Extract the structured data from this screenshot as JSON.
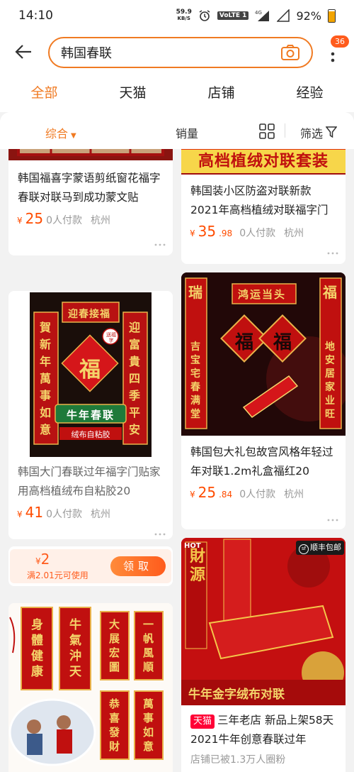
{
  "status_bar": {
    "time": "14:10",
    "net_speed_value": "59.9",
    "net_speed_unit": "KB/S",
    "volte": "VoLTE 1",
    "signal_4g": "4G",
    "battery": "92%"
  },
  "search": {
    "query": "韩国春联",
    "badge_count": "36"
  },
  "tabs": [
    "全部",
    "天猫",
    "店铺",
    "经验"
  ],
  "sort": {
    "comprehensive": "综合",
    "sales": "销量",
    "filter": "筛选"
  },
  "products": [
    {
      "title": "韩国福喜字蒙语剪纸窗花福字春联对联马到成功蒙文贴",
      "price_int": "25",
      "price_dec": "",
      "payers": "0人付款",
      "city": "杭州"
    },
    {
      "banner": "高档植绒对联套装",
      "title": "韩国装小区防盗对联新款2021年高档植绒对联福字门",
      "price_int": "35",
      "price_dec": ".98",
      "payers": "0人付款",
      "city": "杭州"
    },
    {
      "img_top": "迎春接福",
      "img_left": "賀新年萬事如意",
      "img_right": "迎富貴四季平安",
      "img_center": "福",
      "img_tag": "送福字",
      "img_caption": "牛年春联",
      "img_caption2": "绒布自粘胶",
      "title": "韩国大门春联过年福字门贴家用高档植绒布自粘胶20",
      "price_int": "41",
      "price_dec": "",
      "payers": "0人付款",
      "city": "杭州"
    },
    {
      "img_top": "鸿运当头",
      "img_left_char": "瑞",
      "img_right_char": "福",
      "img_left": "吉宝宅春满堂",
      "img_right": "地安居家业旺",
      "img_center": "福",
      "title": "韩国包大礼包故宫风格年轻过年对联1.2m礼盒福红20",
      "price_int": "25",
      "price_dec": ".84",
      "payers": "0人付款",
      "city": "杭州"
    },
    {
      "scrolls": [
        "身體健康",
        "牛氣沖天",
        "大展宏圖",
        "一帆風順",
        "恭喜發財",
        "萬事如意"
      ]
    },
    {
      "img_hot": "HOT",
      "img_sf": "顺丰包邮",
      "img_caption": "牛年金字绒布对联",
      "tmall": "天猫",
      "title": "三年老店 新品上架58天2021牛年创意春联过年",
      "fans": "店铺已被1.3万人圈粉"
    }
  ],
  "coupon": {
    "currency": "¥",
    "amount": "2",
    "condition": "满2.01元可使用",
    "button": "领取"
  },
  "colors": {
    "accent": "#f07a22",
    "price": "#ff4c00",
    "tmall": "#ff0036"
  }
}
